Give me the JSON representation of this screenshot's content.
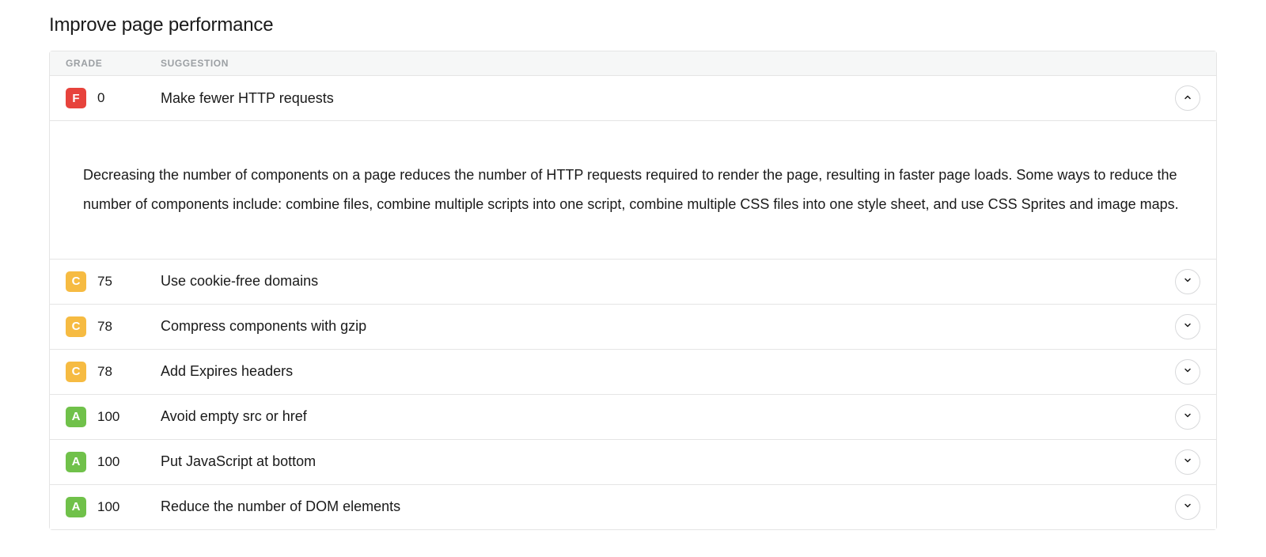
{
  "title": "Improve page performance",
  "table": {
    "headers": {
      "grade": "GRADE",
      "suggestion": "SUGGESTION"
    },
    "rows": [
      {
        "grade_letter": "F",
        "score": "0",
        "suggestion": "Make fewer HTTP requests",
        "expanded": true,
        "detail": "Decreasing the number of components on a page reduces the number of HTTP requests required to render the page, resulting in faster page loads. Some ways to reduce the number of components include: combine files, combine multiple scripts into one script, combine multiple CSS files into one style sheet, and use CSS Sprites and image maps."
      },
      {
        "grade_letter": "C",
        "score": "75",
        "suggestion": "Use cookie-free domains",
        "expanded": false
      },
      {
        "grade_letter": "C",
        "score": "78",
        "suggestion": "Compress components with gzip",
        "expanded": false
      },
      {
        "grade_letter": "C",
        "score": "78",
        "suggestion": "Add Expires headers",
        "expanded": false
      },
      {
        "grade_letter": "A",
        "score": "100",
        "suggestion": "Avoid empty src or href",
        "expanded": false
      },
      {
        "grade_letter": "A",
        "score": "100",
        "suggestion": "Put JavaScript at bottom",
        "expanded": false
      },
      {
        "grade_letter": "A",
        "score": "100",
        "suggestion": "Reduce the number of DOM elements",
        "expanded": false
      }
    ]
  },
  "colors": {
    "grade_F": "#e7433c",
    "grade_C": "#f6bb42",
    "grade_A": "#70c14a"
  }
}
